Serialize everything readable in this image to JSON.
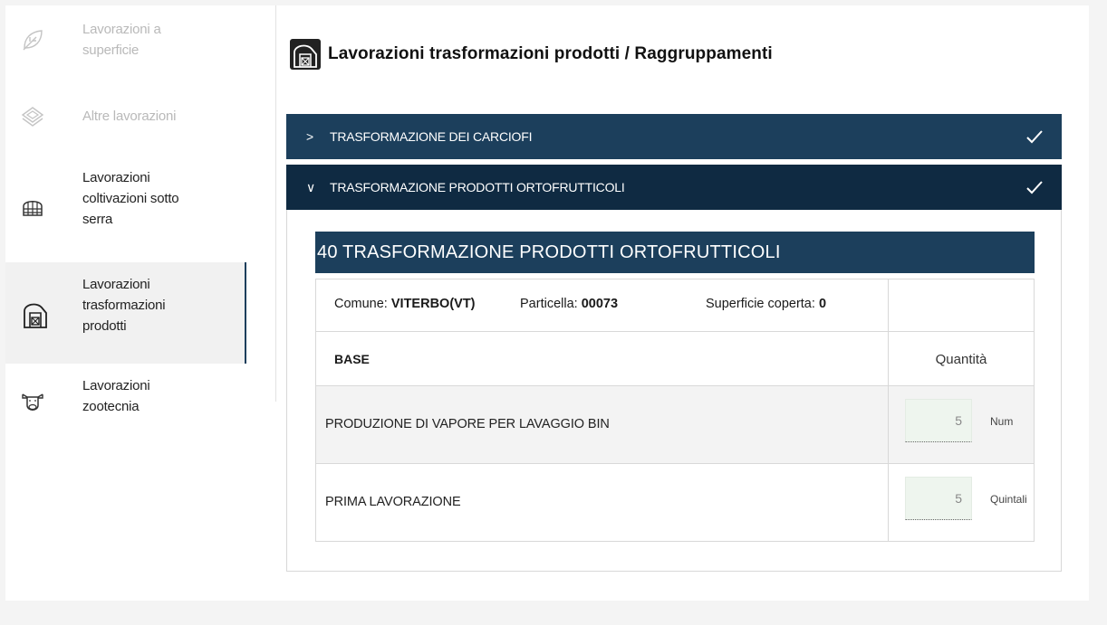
{
  "sidebar": {
    "items": [
      {
        "label_line1": "Lavorazioni a",
        "label_line2": "superficie",
        "label_line3": "",
        "icon": "leaf-icon",
        "state": "disabled"
      },
      {
        "label_line1": "Altre lavorazioni",
        "label_line2": "",
        "label_line3": "",
        "icon": "layers-icon",
        "state": "disabled"
      },
      {
        "label_line1": "Lavorazioni",
        "label_line2": "coltivazioni sotto",
        "label_line3": "serra",
        "icon": "greenhouse-icon",
        "state": "normal"
      },
      {
        "label_line1": "Lavorazioni",
        "label_line2": "trasformazioni",
        "label_line3": "prodotti",
        "icon": "barn-icon",
        "state": "active"
      },
      {
        "label_line1": "Lavorazioni",
        "label_line2": "zootecnia",
        "label_line3": "",
        "icon": "cow-icon",
        "state": "normal"
      }
    ]
  },
  "main": {
    "title": "Lavorazioni trasformazioni prodotti / Raggruppamenti",
    "accordions": [
      {
        "chevron": ">",
        "title": "TRASFORMAZIONE DEI CARCIOFI",
        "expanded": false
      },
      {
        "chevron": "∨",
        "title": "TRASFORMAZIONE PRODOTTI ORTOFRUTTICOLI",
        "expanded": true
      }
    ],
    "group": {
      "heading": "40 TRASFORMAZIONE PRODOTTI ORTOFRUTTICOLI",
      "comune_label": "Comune:",
      "comune_value": "VITERBO(VT)",
      "particella_label": "Particella:",
      "particella_value": "00073",
      "superficie_label": "Superficie coperta:",
      "superficie_value": "0",
      "base_label": "BASE",
      "quantity_header": "Quantità",
      "rows": [
        {
          "label": "PRODUZIONE DI VAPORE PER LAVAGGIO BIN",
          "value": "5",
          "unit": "Num"
        },
        {
          "label": "PRIMA LAVORAZIONE",
          "value": "5",
          "unit": "Quintali"
        }
      ]
    }
  },
  "colors": {
    "accent": "#1c3f5c",
    "accent_dark": "#0f2a42",
    "input_bg": "#eef5ee"
  }
}
